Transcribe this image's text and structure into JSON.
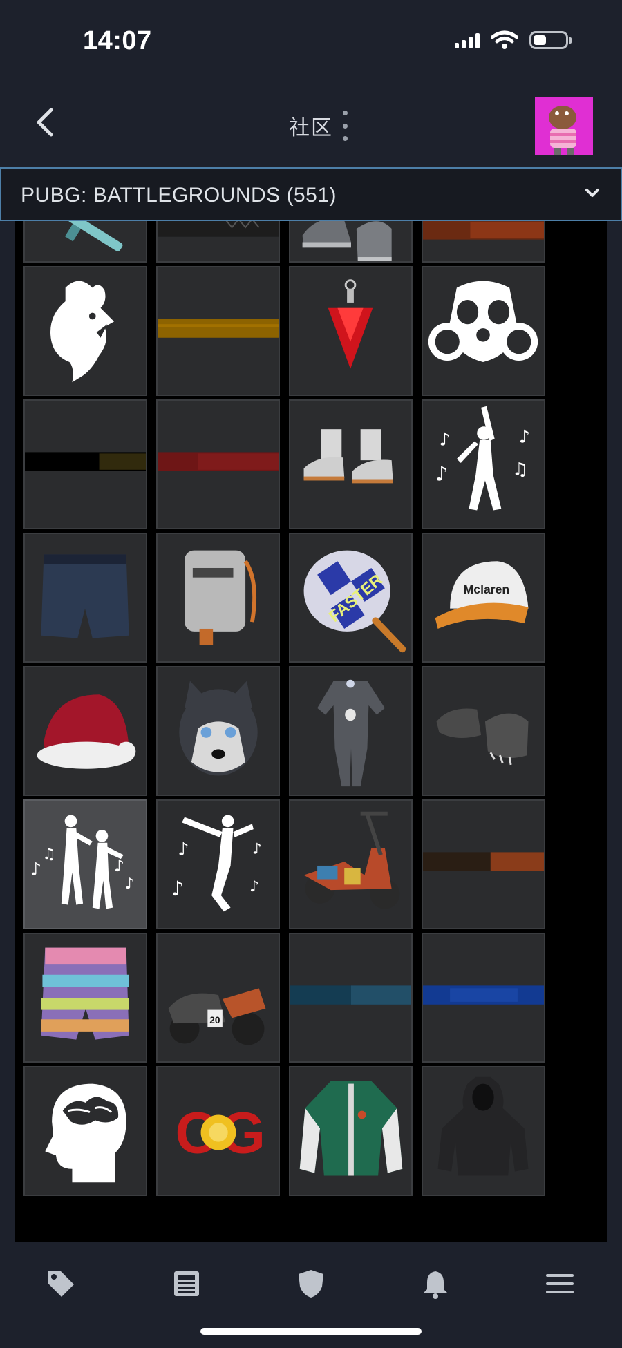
{
  "status_bar": {
    "time": "14:07"
  },
  "header": {
    "title": "社区"
  },
  "game_selector": {
    "label": "PUBG: BATTLEGROUNDS (551)"
  },
  "inventory": {
    "items": [
      [
        "rifle-skin",
        "dark-banner",
        "gray-sneakers",
        "orange-banner"
      ],
      [
        "rooster-emblem",
        "gold-banner",
        "red-pendant",
        "gas-mask-emblem"
      ],
      [
        "black-gold-banner",
        "red-banner",
        "white-orange-sneakers",
        "dance-emote"
      ],
      [
        "denim-shorts",
        "backpack",
        "faster-pan",
        "mclaren-cap"
      ],
      [
        "santa-hat",
        "husky-mask",
        "gray-jumpsuit",
        "monster-gloves"
      ],
      [
        "duo-dance-emote",
        "jump-dance-emote",
        "patchwork-scooter",
        "orange-stripe-banner"
      ],
      [
        "tie-dye-shorts",
        "sidecar-motorcycle",
        "teal-banner",
        "blue-banner"
      ],
      [
        "brain-head-emblem",
        "og-fist-sticker",
        "green-varsity-jacket",
        "black-hoodie"
      ]
    ],
    "selected_item": "duo-dance-emote"
  },
  "tab_bar": {
    "items": [
      "tag-icon",
      "news-icon",
      "shield-icon",
      "bell-icon",
      "menu-icon"
    ]
  }
}
